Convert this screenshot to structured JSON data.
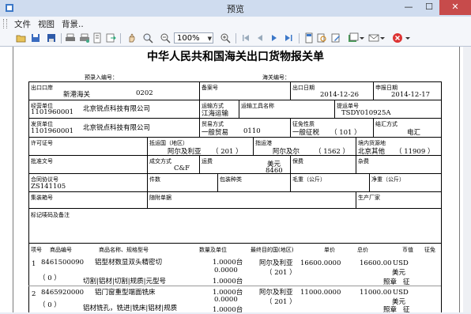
{
  "window": {
    "title": "预览",
    "min_glyph": "—",
    "max_glyph": "☐",
    "close_glyph": "✕"
  },
  "menu": [
    "文件",
    "视图",
    "背景.."
  ],
  "toolbar": {
    "zoom": "100%"
  },
  "doc": {
    "title": "中华人民共和国海关出口货物报关单",
    "prerecord_label": "预录入编号：",
    "customs_no_label": "海关编号：",
    "customs_no": "020220140521025413",
    "labels": {
      "export_port": "出口口岸",
      "filing_no": "备案号",
      "export_date": "出口日期",
      "declare_date": "申报日期",
      "business_unit": "经营单位",
      "transport_mode": "运输方式",
      "transport_tool": "运输工具名称",
      "bill_no": "提运单号",
      "shipper": "发货单位",
      "trade_mode": "贸易方式",
      "levy_nature": "征免性质",
      "settlement": "结汇方式",
      "license_no": "许可证号",
      "dest_country": "抵运国（地区）",
      "dest_port": "指运港",
      "domestic_source": "境内货源地",
      "approval_no": "批准文号",
      "deal_mode": "成交方式",
      "freight": "运费",
      "insurance": "保费",
      "misc_fee": "杂费",
      "contract_no": "合同协议号",
      "pieces": "件数",
      "packing": "包装种类",
      "gross_weight": "毛重（公斤）",
      "net_weight": "净重（公斤）",
      "container_no": "集装箱号",
      "attached_docs": "随附单据",
      "manufacturer": "生产厂家",
      "marks": "标记唛码及备注"
    },
    "values": {
      "export_port": "新港海关",
      "export_port_code": "0202",
      "export_date": "2014-12-26",
      "declare_date": "2014-12-17",
      "business_unit_code": "1101960001",
      "business_unit_name": "北京锐点科技有限公司",
      "transport_mode": "江海运输",
      "bill_no": "TSDY010925A",
      "shipper_code": "1101960001",
      "shipper_name": "北京锐点科技有限公司",
      "trade_mode": "一般贸易",
      "trade_mode_code": "0110",
      "levy_nature": "一般征税",
      "levy_code": "（ 101 ）",
      "settlement": "电汇",
      "dest_country": "阿尔及利亚",
      "dest_country_code": "（ 201 ）",
      "dest_port": "阿尔及尔",
      "dest_port_code": "（ 1562 ）",
      "domestic_source": "北京其他",
      "domestic_source_code": "（ 11909 ）",
      "deal_mode": "C&F",
      "freight_currency": "美元",
      "freight_amount": "8460",
      "contract_no": "ZS141105"
    },
    "goods_headers": [
      "项号",
      "商品编号",
      "商品名称、规格型号",
      "数量及单位",
      "最终目的国(地区)",
      "单价",
      "总价",
      "币值",
      "征免"
    ],
    "goods": [
      {
        "no": "1",
        "code": "8461500090",
        "sub": "（  0  ）",
        "name": "铝型材数显双头精密切",
        "spec": "切割|铝材|切割|规质|元型号",
        "qty1": "1.0000台",
        "qty2": "0.0000",
        "qty3": "1.0000台",
        "country": "阿尔及利亚",
        "country_code": "（ 201 ）",
        "unit_price": "16600.0000",
        "total": "16600.00",
        "currency": "USD",
        "currency_name": "美元",
        "levy": "照章",
        "levy_tail": "征"
      },
      {
        "no": "2",
        "code": "8465920000",
        "sub": "（  0  ）",
        "name": "铝门窗重型端面铣床",
        "spec": "铝材铣孔，铣进|铣床|铝材|规质",
        "qty1": "1.0000台",
        "qty2": "0.0000",
        "qty3": "1.0000台",
        "country": "阿尔及利亚",
        "country_code": "（ 201 ）",
        "unit_price": "11000.0000",
        "total": "11000.00",
        "currency": "USD",
        "currency_name": "美元",
        "levy": "照章",
        "levy_tail": "征"
      }
    ]
  }
}
